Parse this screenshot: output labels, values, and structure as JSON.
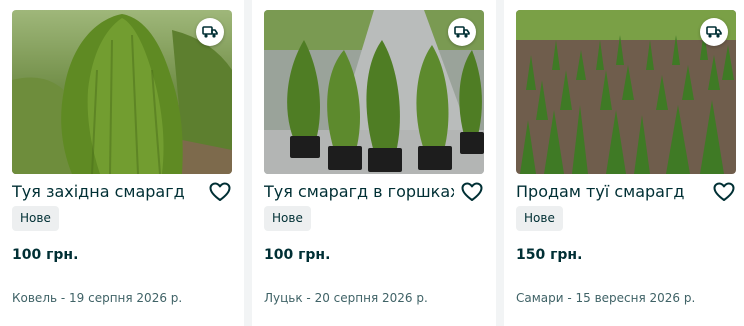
{
  "listings": [
    {
      "title": "Туя західна смарагд",
      "condition": "Нове",
      "price": "100 грн.",
      "location_date": "Ковель - 19 серпня 2026 р.",
      "delivery_icon": "truck-icon",
      "favorite_icon": "heart-outline-icon"
    },
    {
      "title": "Туя смарагд в горшках",
      "condition": "Нове",
      "price": "100 грн.",
      "location_date": "Луцьк - 20 серпня 2026 р.",
      "delivery_icon": "truck-icon",
      "favorite_icon": "heart-outline-icon"
    },
    {
      "title": "Продам туї смарагд",
      "condition": "Нове",
      "price": "150 грн.",
      "location_date": "Самари - 15 вересня 2026 р.",
      "delivery_icon": "truck-icon",
      "favorite_icon": "heart-outline-icon"
    }
  ],
  "colors": {
    "text": "#002f34",
    "muted": "#406367",
    "badge_bg": "#edeff0",
    "page_bg": "#f2f4f5"
  }
}
